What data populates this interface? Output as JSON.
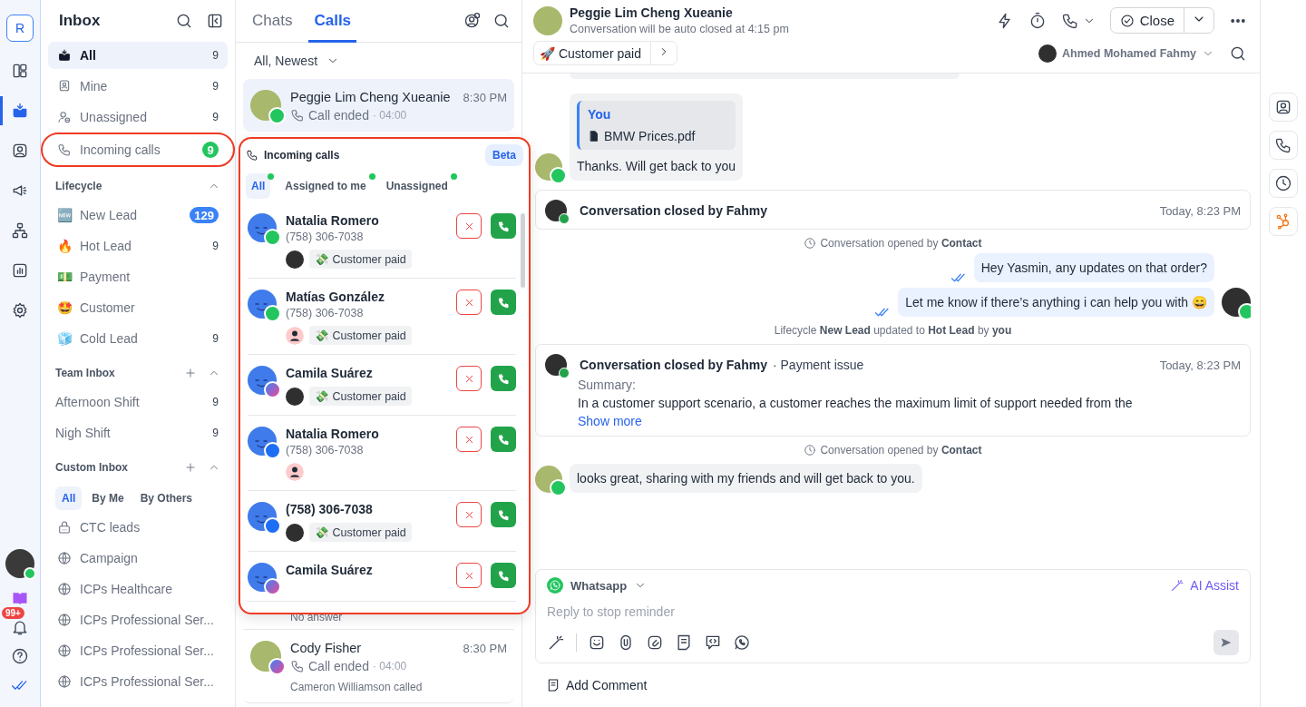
{
  "rail": {
    "logo": "R",
    "items": [
      {
        "selected": false
      },
      {
        "selected": true
      },
      {
        "selected": false
      },
      {
        "selected": false
      },
      {
        "selected": false
      },
      {
        "selected": false
      },
      {
        "selected": false
      }
    ],
    "notifications": "99+"
  },
  "sidebar": {
    "title": "Inbox",
    "items": [
      {
        "label": "All",
        "count": "9",
        "selected": true,
        "highlighted": false
      },
      {
        "label": "Mine",
        "count": "9",
        "selected": false,
        "highlighted": false
      },
      {
        "label": "Unassigned",
        "count": "9",
        "selected": false,
        "highlighted": false
      },
      {
        "label": "Incoming calls",
        "count": "9",
        "color": "#22c55e",
        "selected": false,
        "highlighted": true
      }
    ],
    "sections": [
      {
        "title": "Lifecycle",
        "addable": false,
        "expanded": true,
        "items": [
          {
            "emoji": "🆕",
            "label": "New Lead",
            "count": "129",
            "color": "#3b82f6"
          },
          {
            "emoji": "🔥",
            "label": "Hot Lead",
            "count": "9"
          },
          {
            "emoji": "💵",
            "label": "Payment"
          },
          {
            "emoji": "🤩",
            "label": "Customer"
          },
          {
            "emoji": "🧊",
            "label": "Cold Lead",
            "count": "9"
          }
        ]
      },
      {
        "title": "Team Inbox",
        "addable": true,
        "expanded": true,
        "items": [
          {
            "label": "Afternoon Shift",
            "count": "9"
          },
          {
            "label": "Nigh Shift",
            "count": "9"
          }
        ]
      },
      {
        "title": "Custom Inbox",
        "addable": true,
        "expanded": true,
        "tabs": [
          {
            "label": "All",
            "selected": true
          },
          {
            "label": "By Me",
            "selected": false
          },
          {
            "label": "By Others",
            "selected": false
          }
        ],
        "items": [
          {
            "kind": "private",
            "label": "CTC leads"
          },
          {
            "kind": "public",
            "label": "Campaign"
          },
          {
            "kind": "public",
            "label": "ICPs Healthcare"
          },
          {
            "kind": "public",
            "label": "ICPs Professional Ser..."
          },
          {
            "kind": "public",
            "label": "ICPs Professional Ser..."
          },
          {
            "kind": "public",
            "label": "ICPs Professional Ser..."
          }
        ]
      }
    ]
  },
  "list": {
    "tabs": [
      {
        "label": "Chats",
        "selected": false
      },
      {
        "label": "Calls",
        "selected": true
      }
    ],
    "filter": "All, Newest",
    "conversations": [
      {
        "kind": "call",
        "name": "Peggie Lim Cheng Xueanie",
        "time": "8:30 PM",
        "status": "Call ended",
        "duration": "· 04:00",
        "channel": {
          "kind": "whatsapp"
        },
        "selected": true
      },
      {
        "kind": "covered",
        "preview": "No answer"
      },
      {
        "kind": "call",
        "name": "Cody Fisher",
        "time": "8:30 PM",
        "status": "Call ended",
        "duration": "· 04:00",
        "channel": {
          "kind": "messenger"
        },
        "selected": false,
        "preview": "Cameron Williamson called"
      }
    ],
    "incoming": {
      "title": "Incoming calls",
      "badge": "Beta",
      "highlighted": true,
      "tabs": [
        {
          "label": "All",
          "selected": true
        },
        {
          "label": "Assigned to me",
          "selected": false
        },
        {
          "label": "Unassigned",
          "selected": false
        }
      ],
      "calls": [
        {
          "name": "Natalia Romero",
          "phone": "(758) 306-7038",
          "channel": {
            "kind": "whatsapp"
          },
          "assignee": {
            "kind": "agent"
          },
          "tag": {
            "emoji": "💸",
            "label": "Customer paid"
          }
        },
        {
          "name": "Matías González",
          "phone": "(758) 306-7038",
          "channel": {
            "kind": "whatsapp"
          },
          "assignee": {
            "kind": "unassigned"
          },
          "tag": {
            "emoji": "💸",
            "label": "Customer paid"
          }
        },
        {
          "name": "Camila Suárez",
          "channel": {
            "kind": "messenger"
          },
          "assignee": {
            "kind": "agent"
          },
          "tag": {
            "emoji": "💸",
            "label": "Customer paid"
          }
        },
        {
          "name": "Natalia Romero",
          "phone": "(758) 306-7038",
          "channel": {
            "kind": "phone"
          },
          "assignee": {
            "kind": "unassigned"
          }
        },
        {
          "name": "(758) 306-7038",
          "channel": {
            "kind": "phone"
          },
          "assignee": {
            "kind": "agent"
          },
          "tag": {
            "emoji": "💸",
            "label": "Customer paid"
          }
        },
        {
          "name": "Camila Suárez",
          "channel": {
            "kind": "messenger"
          }
        }
      ]
    }
  },
  "chat": {
    "header": {
      "name": "Peggie Lim Cheng Xueanie",
      "subtitle": "Conversation will be auto closed at 4:15 pm",
      "close": "Close",
      "tag": {
        "emoji": "🚀",
        "label": "Customer paid"
      },
      "assignee": "Ahmed Mohamed Fahmy"
    },
    "messages": [
      {
        "kind": "incoming",
        "quote": {
          "author": "You",
          "file": "BMW Prices.pdf"
        },
        "text": "Thanks. Will get back to you"
      },
      {
        "kind": "event",
        "title": "Conversation closed by Fahmy",
        "time": "Today, 8:23 PM"
      },
      {
        "kind": "opened",
        "text": "Conversation opened by **Contact**"
      },
      {
        "kind": "outgoing",
        "text": "Hey Yasmin, any updates on that order?",
        "avatar": false
      },
      {
        "kind": "outgoing",
        "text": "Let me know if there’s anything i can help you with 😄",
        "avatar": true
      },
      {
        "kind": "system",
        "text": "Lifecycle **New Lead** updated to **Hot Lead** by **you**"
      },
      {
        "kind": "event",
        "title": "Conversation closed by Fahmy",
        "topic": "· Payment issue",
        "time": "Today, 8:23 PM",
        "summary_label": "Summary:",
        "summary": "In a customer support scenario, a customer reaches the maximum limit of support needed from the",
        "link": "Show more"
      },
      {
        "kind": "opened",
        "text": "Conversation opened by **Contact**"
      },
      {
        "kind": "incoming",
        "text": "looks great, sharing with my friends and will get back to you."
      }
    ],
    "composer": {
      "channel": "Whatsapp",
      "ai": "AI Assist",
      "placeholder": "Reply to stop reminder"
    },
    "add_comment": "Add Comment"
  }
}
